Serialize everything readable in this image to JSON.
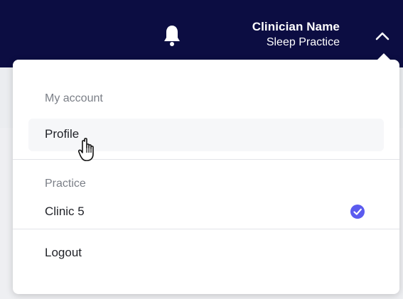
{
  "header": {
    "user_name": "Clinician Name",
    "practice_name": "Sleep Practice"
  },
  "icons": {
    "bell": "bell-icon",
    "chevron": "chevron-up-icon",
    "check": "check-circle-icon",
    "cursor": "hand-pointer-cursor-icon"
  },
  "menu": {
    "my_account_label": "My account",
    "profile_label": "Profile",
    "practice_label": "Practice",
    "clinic_label": "Clinic 5",
    "logout_label": "Logout"
  },
  "colors": {
    "header_bg": "#0c0d42",
    "check_accent": "#5b5bef"
  }
}
